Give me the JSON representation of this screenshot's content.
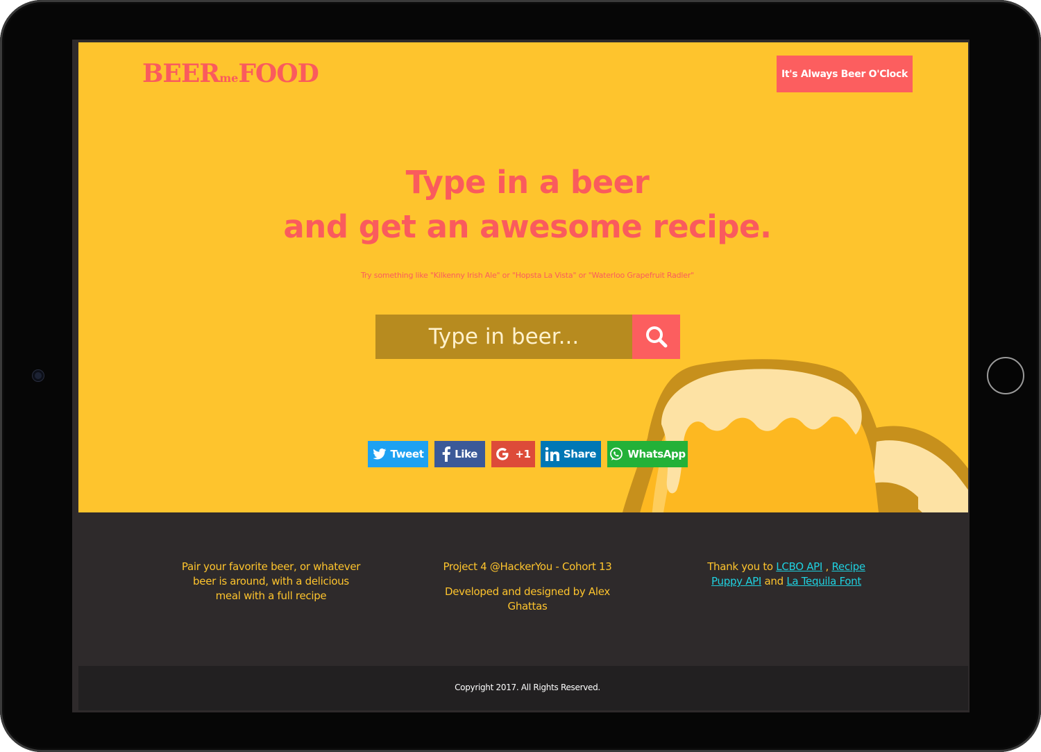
{
  "colors": {
    "hero_bg": "#fec42d",
    "accent": "#fa5b5d",
    "search_field": "#b78b1f",
    "footer_bg": "#2e2a2b",
    "copy_bg": "#222021",
    "footer_text": "#fec42d",
    "link": "#1fd1e0"
  },
  "header": {
    "logo": {
      "part1": "BEER",
      "part2": "me",
      "part3": "FOOD"
    },
    "cta_label": "It's Always Beer O'Clock"
  },
  "hero": {
    "headline_line1": "Type in a beer",
    "headline_line2": "and get an awesome recipe.",
    "hint": "Try something like \"Kilkenny Irish Ale\" or \"Hopsta La Vista\" or \"Waterloo Grapefruit Radler\""
  },
  "search": {
    "placeholder": "Type in beer...",
    "value": "",
    "button_icon": "search-icon"
  },
  "share": {
    "buttons": [
      {
        "label": "Tweet",
        "icon": "twitter-icon",
        "color": "#1da1f2"
      },
      {
        "label": "Like",
        "icon": "facebook-icon",
        "color": "#3b5998"
      },
      {
        "label": "+1",
        "icon": "google-icon",
        "color": "#dd4b39"
      },
      {
        "label": "Share",
        "icon": "linkedin-icon",
        "color": "#0077b5"
      },
      {
        "label": "WhatsApp",
        "icon": "whatsapp-icon",
        "color": "#23b138"
      }
    ]
  },
  "footer": {
    "about": "Pair your favorite beer, or whatever beer is around, with a delicious meal with a full recipe",
    "project": "Project 4 @HackerYou - Cohort 13",
    "credit": "Developed and designed by Alex Ghattas",
    "thanks_prefix": "Thank you to",
    "link_lcbo": "LCBO API",
    "sep_comma": ",",
    "link_recipe": "Recipe Puppy API",
    "sep_and": "and",
    "link_font": "La Tequila Font",
    "copyright": "Copyright 2017. All Rights Reserved."
  }
}
